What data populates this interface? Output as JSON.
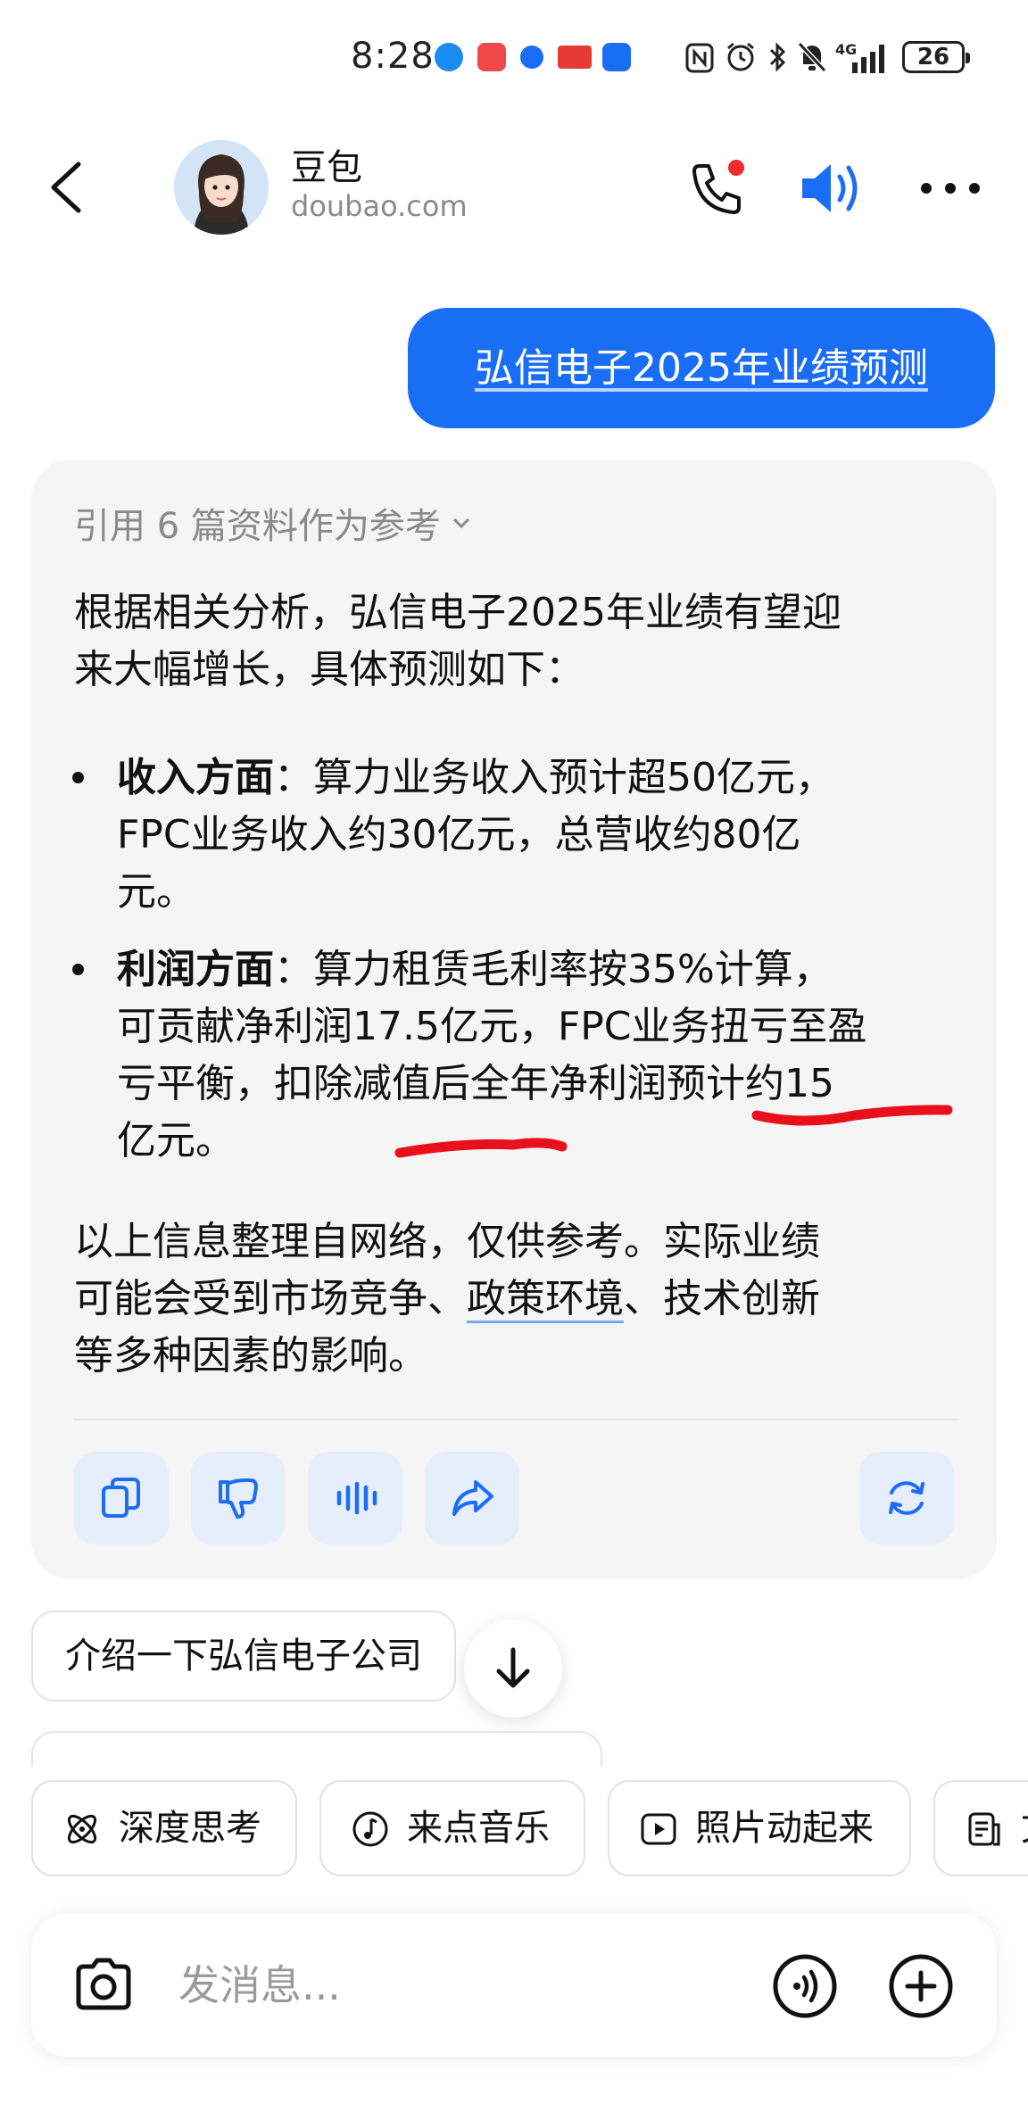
{
  "status": {
    "time": "8:28",
    "battery": "26",
    "network": "4G"
  },
  "header": {
    "title": "豆包",
    "subtitle": "doubao.com"
  },
  "user_message": "弘信电子2025年业绩预测",
  "reply": {
    "references": "引用 6 篇资料作为参考",
    "intro_line1": "根据相关分析，弘信电子2025年业绩有望迎",
    "intro_line2": "来大幅增长，具体预测如下：",
    "bullet1": {
      "label": "收入方面",
      "line1": "：算力业务收入预计超50亿元，",
      "line2": "FPC业务收入约30亿元，总营收约80亿",
      "line3": "元。"
    },
    "bullet2": {
      "label": "利润方面",
      "line1": "：算力租赁毛利率按35%计算，",
      "line2": "可贡献净利润17.5亿元，FPC业务扭亏至盈",
      "line3": "亏平衡，扣除减值后全年净利润预计约15",
      "line4": "亿元。"
    },
    "outro_line1": "以上信息整理自网络，仅供参考。实际业绩",
    "outro_line2a": "可能会受到市场竞争、",
    "outro_line2_link": "政策环境",
    "outro_line2b": "、技术创新",
    "outro_line3": "等多种因素的影响。"
  },
  "suggestions": [
    "介绍一下弘信电子公司"
  ],
  "tools": [
    "深度思考",
    "来点音乐",
    "照片动起来",
    "文"
  ],
  "input": {
    "placeholder": "发消息..."
  },
  "colors": {
    "accent": "#1a6df5",
    "annotation": "#e8111b",
    "card_bg": "#f5f5f6"
  }
}
